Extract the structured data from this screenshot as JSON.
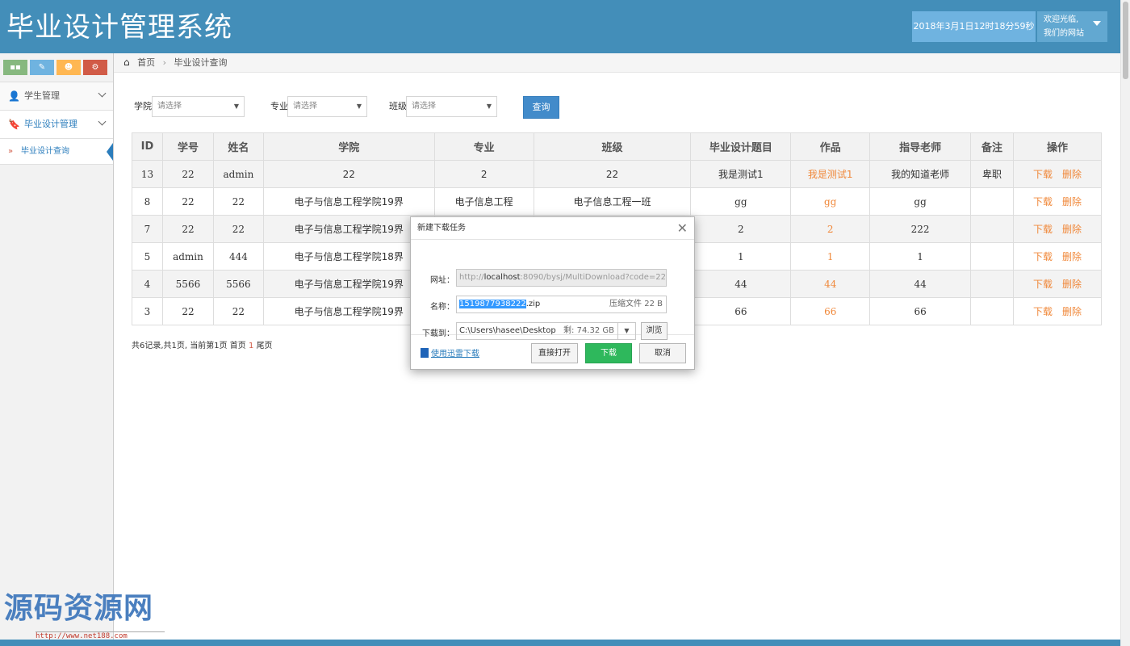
{
  "header": {
    "title": "毕业设计管理系统",
    "datetime": "2018年3月1日12时18分59秒",
    "welcome": "欢迎光临,",
    "site": "我们的网站"
  },
  "shortcuts": [
    {
      "icon": "signal-icon",
      "glyph": "▪▪",
      "color": "#87b87f"
    },
    {
      "icon": "pencil-icon",
      "glyph": "✎",
      "color": "#6fb3e0"
    },
    {
      "icon": "users-icon",
      "glyph": "☻",
      "color": "#ffb752"
    },
    {
      "icon": "cogs-icon",
      "glyph": "⚙",
      "color": "#d15b47"
    }
  ],
  "sidebar": {
    "items": [
      {
        "label": "学生管理"
      },
      {
        "label": "毕业设计管理"
      }
    ],
    "sub_items": [
      {
        "label": "毕业设计查询"
      }
    ]
  },
  "breadcrumb": {
    "home": "首页",
    "current": "毕业设计查询"
  },
  "filters": {
    "college_label": "学院",
    "major_label": "专业",
    "class_label": "班级",
    "placeholder": "请选择",
    "query_button": "查询"
  },
  "table": {
    "headers": [
      "ID",
      "学号",
      "姓名",
      "学院",
      "专业",
      "班级",
      "毕业设计题目",
      "作品",
      "指导老师",
      "备注",
      "操作"
    ],
    "rows": [
      [
        "13",
        "22",
        "admin",
        "22",
        "2",
        "22",
        "我是测试1",
        "我是测试1",
        "我的知道老师",
        "卑职"
      ],
      [
        "8",
        "22",
        "22",
        "电子与信息工程学院19界",
        "电子信息工程",
        "电子信息工程一班",
        "gg",
        "gg",
        "gg",
        ""
      ],
      [
        "7",
        "22",
        "22",
        "电子与信息工程学院19界",
        "",
        "",
        "2",
        "2",
        "222",
        ""
      ],
      [
        "5",
        "admin",
        "444",
        "电子与信息工程学院18界",
        "",
        "",
        "1",
        "1",
        "1",
        ""
      ],
      [
        "4",
        "5566",
        "5566",
        "电子与信息工程学院19界",
        "",
        "",
        "44",
        "44",
        "44",
        ""
      ],
      [
        "3",
        "22",
        "22",
        "电子与信息工程学院19界",
        "",
        "",
        "66",
        "66",
        "66",
        ""
      ]
    ],
    "download_label": "下载",
    "delete_label": "删除"
  },
  "pager": {
    "text_before": "共6记录,共1页, 当前第1页 首页",
    "current": "1",
    "text_after": "尾页"
  },
  "dialog": {
    "title": "新建下载任务",
    "url_label": "网址：",
    "url_prefix": "http://",
    "url_host": "localhost",
    "url_rest": ":8090/bysj/MultiDownload?code=22",
    "name_label": "名称：",
    "name_selected": "1519877938222",
    "name_ext": ".zip",
    "name_meta": "压缩文件 22 B",
    "path_label": "下载到：",
    "path_value": "C:\\Users\\hasee\\Desktop",
    "path_meta": "剩: 74.32 GB",
    "browse_button": "浏览",
    "thunder_link": "使用迅雷下载",
    "open_button": "直接打开",
    "download_button": "下载",
    "cancel_button": "取消",
    "download_color": "#2eb85c"
  },
  "watermark": {
    "text": "源码资源网",
    "url": "http://www.net188.com"
  }
}
